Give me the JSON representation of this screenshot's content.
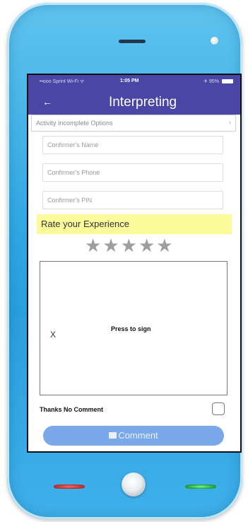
{
  "status_bar": {
    "carrier": "••ooo Sprint Wi-Fi ᯤ",
    "time": "1:05 PM",
    "battery": "✈ 95%"
  },
  "navbar": {
    "back_icon": "back-arrow-icon",
    "back_glyph": "←",
    "title": "Interpreting",
    "background": "#4a46a6"
  },
  "incomplete_options": {
    "label": "Activity Incomplete Options",
    "chevron": "›"
  },
  "form": {
    "confirmer_name_placeholder": "Confirmer's Name",
    "confirmer_phone_placeholder": "Confirmer's Phone",
    "confirmer_pin_placeholder": "Confirmer's PIN"
  },
  "rating": {
    "label": "Rate your Experience",
    "highlight_color": "#fbfb9c",
    "stars": [
      "★",
      "★",
      "★",
      "★",
      "★"
    ],
    "value": 0,
    "max": 5
  },
  "signature": {
    "x_mark": "X",
    "prompt": "Press to sign"
  },
  "comment": {
    "thanks_label": "Thanks No Comment",
    "checked": false,
    "button_icon": "comment-icon",
    "button_label": "Comment",
    "button_color": "#7aa8ea"
  }
}
